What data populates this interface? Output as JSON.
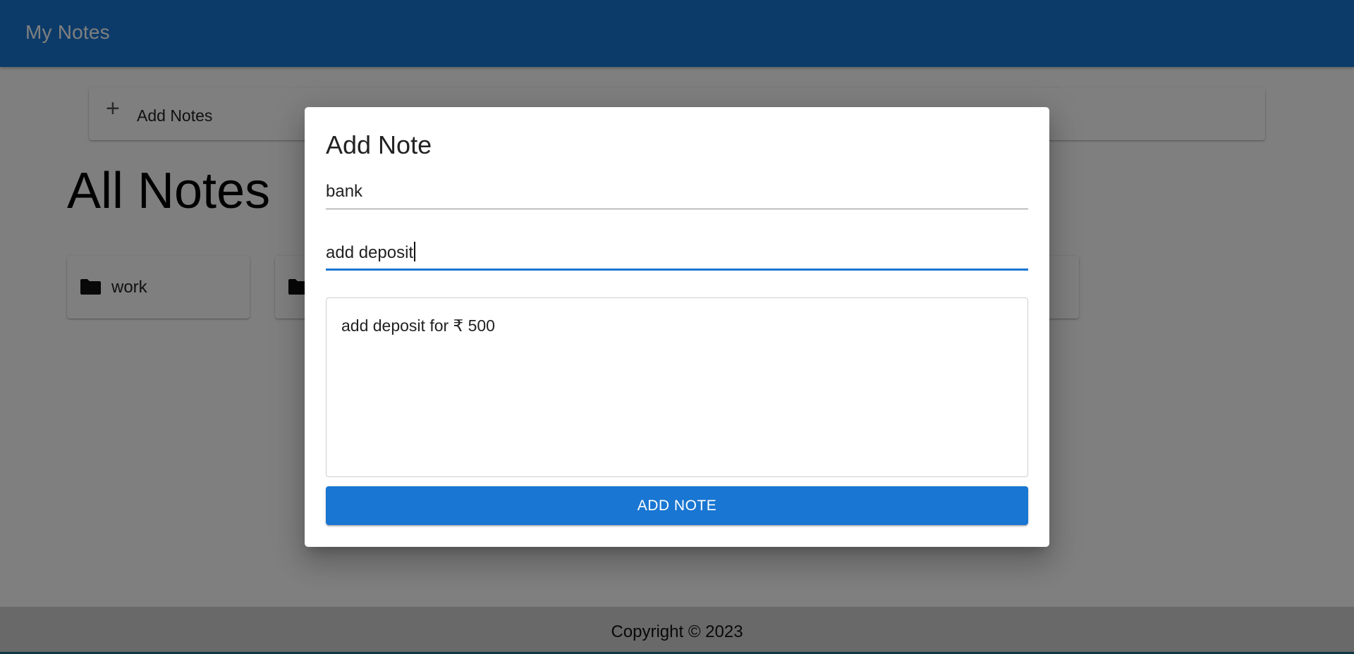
{
  "app": {
    "title": "My Notes"
  },
  "add_bar": {
    "icon": "plus-icon",
    "label": "Add Notes"
  },
  "heading": "All Notes",
  "folders": [
    {
      "label": "work",
      "icon": "folder-icon"
    },
    {
      "label": "",
      "icon": "folder-icon"
    }
  ],
  "footer": {
    "text": "Copyright © 2023"
  },
  "dialog": {
    "title": "Add Note",
    "title_field": {
      "value": "bank"
    },
    "subtitle_field": {
      "value": "add deposit"
    },
    "body_field": {
      "value": "add deposit for ₹ 500"
    },
    "submit_label": "ADD NOTE"
  },
  "colors": {
    "primary": "#1976d2",
    "backdrop": "rgba(0,0,0,0.5)"
  }
}
